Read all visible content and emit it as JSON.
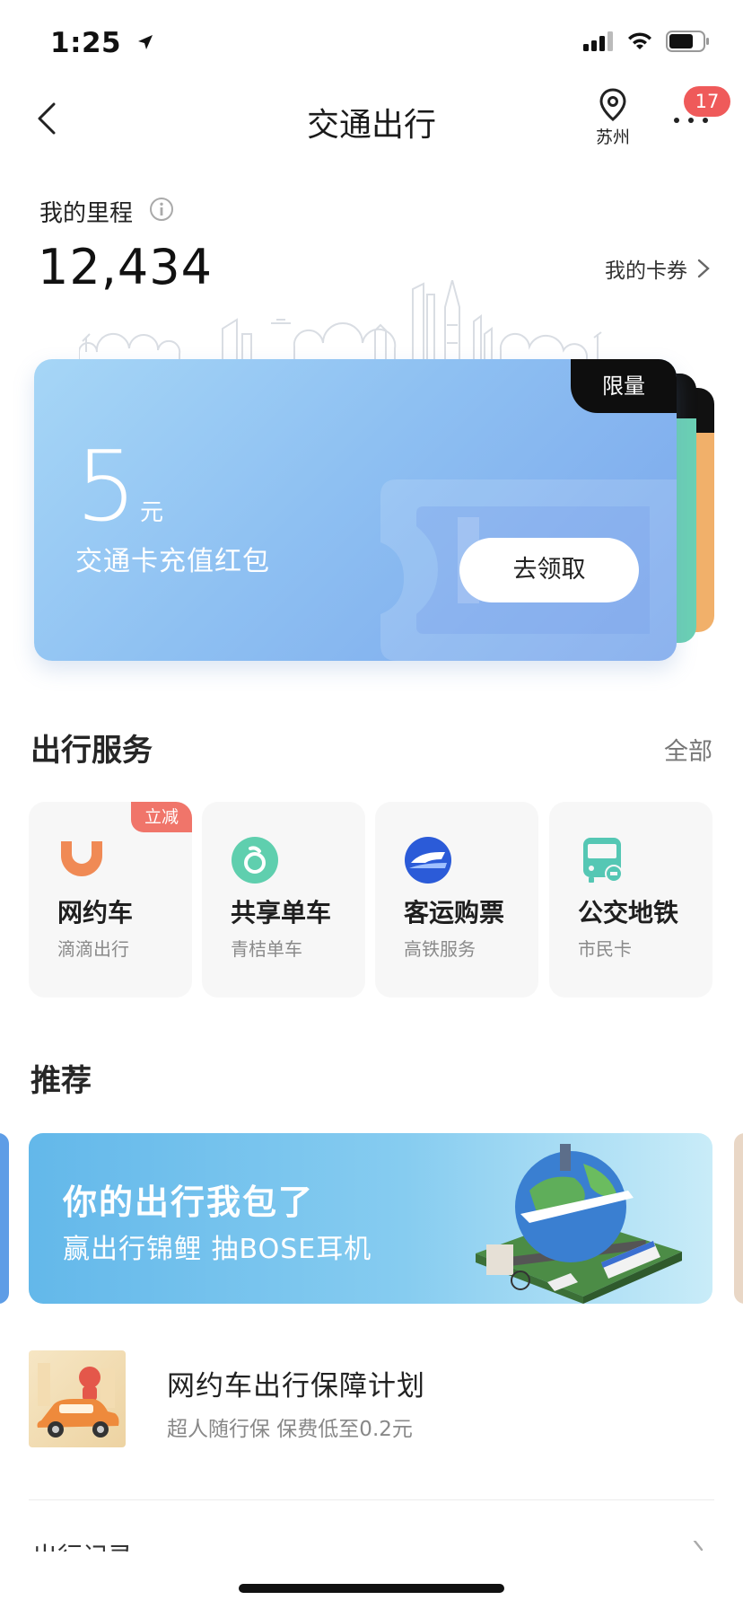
{
  "status_bar": {
    "time": "1:25"
  },
  "nav": {
    "title": "交通出行",
    "location": "苏州",
    "notification_count": "17"
  },
  "mileage": {
    "label": "我的里程",
    "value": "12,434",
    "coupon_link": "我的卡券"
  },
  "promo_card": {
    "tag": "限量",
    "amount": "5",
    "unit": "元",
    "description": "交通卡充值红包",
    "button": "去领取",
    "stack_colors": [
      "#6bd0b4",
      "#f1b06a"
    ]
  },
  "services": {
    "title": "出行服务",
    "all_link": "全部",
    "items": [
      {
        "name": "网约车",
        "sub": "滴滴出行",
        "tag": "立减",
        "icon": "didi-icon"
      },
      {
        "name": "共享单车",
        "sub": "青桔单车",
        "icon": "bike-icon"
      },
      {
        "name": "客运购票",
        "sub": "高铁服务",
        "icon": "train-icon"
      },
      {
        "name": "公交地铁",
        "sub": "市民卡",
        "icon": "bus-icon"
      }
    ]
  },
  "recommend": {
    "title": "推荐",
    "banner": {
      "title": "你的出行我包了",
      "subtitle": "赢出行锦鲤 抽BOSE耳机"
    },
    "insurance": {
      "title": "网约车出行保障计划",
      "subtitle": "超人随行保 保费低至0.2元"
    },
    "next_section_peek": "出行记录"
  },
  "colors": {
    "accent_blue": "#7aa6ec",
    "badge_red": "#ef5a5a",
    "didi_orange": "#f08a55",
    "bike_green": "#5fcfae"
  }
}
